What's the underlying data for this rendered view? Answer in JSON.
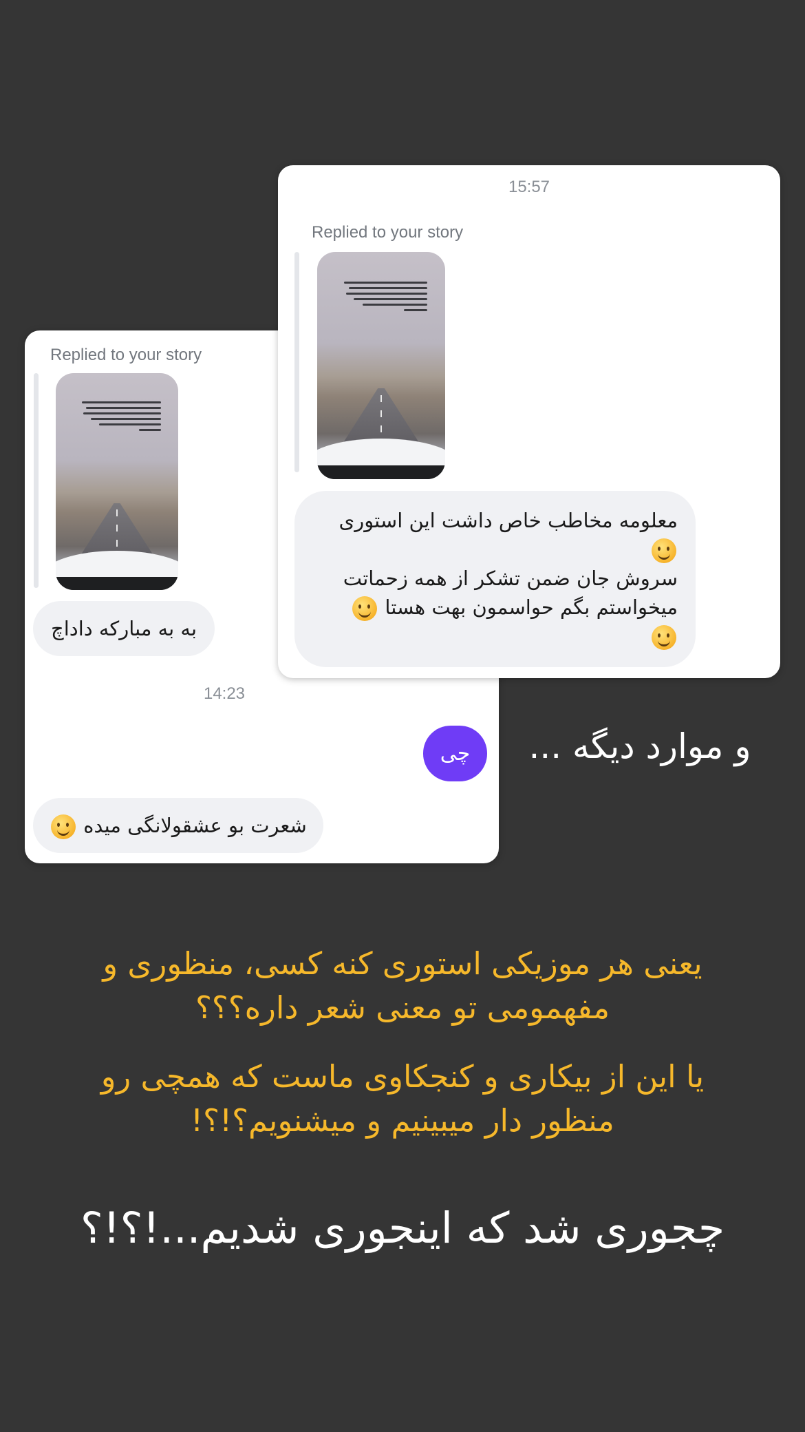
{
  "card_right": {
    "timestamp": "15:57",
    "replied_label": "Replied to your story",
    "message_lines": [
      "معلومه مخاطب خاص داشت این استوری",
      "سروش جان ضمن تشکر از همه زحماتت",
      "میخواستم بگم حواسمون بهت هستا"
    ]
  },
  "card_left": {
    "replied_label": "Replied to your story",
    "message_congrats": "به به مبارکه داداچ",
    "timestamp": "14:23",
    "sent_message": "چی",
    "message_poem": "شعرت بو عشقولانگی میده"
  },
  "overlay": {
    "others": "و موارد دیگه ...",
    "question_1": "یعنی هر موزیکی استوری کنه کسی، منظوری و مفهمومی تو معنی شعر داره؟؟؟",
    "question_2": "یا این از بیکاری و کنجکاوی ماست که همچی رو منظور دار میبینیم و میشنویم؟!؟!",
    "question_3": "چجوری شد که اینجوری شدیم...!؟!؟"
  },
  "colors": {
    "background": "#353535",
    "accent_yellow": "#f6b82b",
    "sent_bubble": "#6f3cf6",
    "received_bubble": "#f0f1f4"
  },
  "icons": [
    "upside-down-face-emoji",
    "grinning-face-emoji",
    "winking-face-emoji",
    "rolling-laughing-emoji"
  ]
}
